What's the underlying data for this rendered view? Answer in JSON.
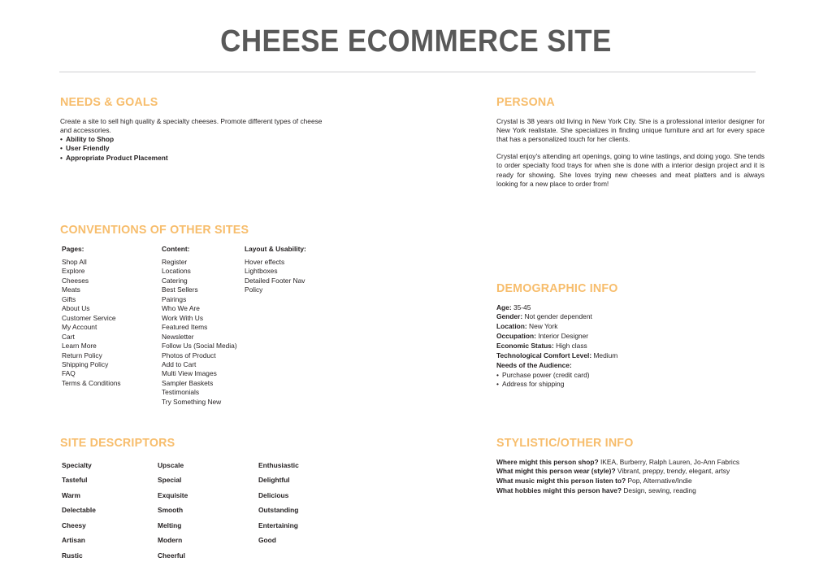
{
  "document": {
    "title": "CHEESE ECOMMERCE SITE",
    "title_color": "#595959",
    "accent_color": "#f7bd6c",
    "rule_color": "#cfd0d2"
  },
  "needs_goals": {
    "heading": "NEEDS & GOALS",
    "paragraph": "Create a site to sell high quality & specialty cheeses. Promote different types of cheese and accessories.",
    "bullets": [
      "Ability to Shop",
      "User Friendly",
      "Appropriate Product Placement"
    ]
  },
  "persona": {
    "heading": "PERSONA",
    "paragraph1": "Crystal is 38 years old living in New York City. She is a professional interior designer for New York realistate. She specializes in finding unique furniture and art for every space that has a personalized touch for her clients.",
    "paragraph2": "Crystal enjoy's attending art openings, going to wine tastings, and doing yogo. She tends to order specialty food trays for when she is done with a interior design project and it is ready for showing. She loves trying new cheeses and meat platters and is always looking for a new place to order from!"
  },
  "conventions": {
    "heading": "CONVENTIONS OF OTHER SITES",
    "columns": [
      {
        "header": "Pages:",
        "items": [
          "Shop All",
          "Explore",
          "Cheeses",
          "Meats",
          "Gifts",
          "About Us",
          "Customer Service",
          "My Account",
          "Cart",
          "Learn More",
          "Return Policy",
          "Shipping Policy",
          "FAQ",
          "Terms & Conditions"
        ]
      },
      {
        "header": "Content:",
        "items": [
          "Register",
          "Locations",
          "Catering",
          "Best Sellers",
          "Pairings",
          "Who We Are",
          "Work With Us",
          "Featured Items",
          "Newsletter",
          "Follow Us (Social Media)",
          "Photos of Product",
          "Add to Cart",
          "Multi View Images",
          "Sampler Baskets",
          "Testimonials",
          "Try Something New"
        ]
      },
      {
        "header": "Layout & Usability:",
        "items": [
          "Hover effects",
          "Lightboxes",
          "Detailed Footer Nav",
          "Policy"
        ]
      }
    ]
  },
  "demographic": {
    "heading": "DEMOGRAPHIC INFO",
    "fields": [
      {
        "label": "Age:",
        "value": "35-45"
      },
      {
        "label": "Gender:",
        "value": "Not gender dependent"
      },
      {
        "label": "Location:",
        "value": "New York"
      },
      {
        "label": "Occupation:",
        "value": "Interior Designer"
      },
      {
        "label": "Economic Status:",
        "value": "High class"
      },
      {
        "label": "Technological Comfort Level:",
        "value": "Medium"
      }
    ],
    "audience_label": "Needs of the Audience:",
    "audience_bullets": [
      "Purchase power (credit card)",
      "Address for shipping"
    ]
  },
  "site_descriptors": {
    "heading": "SITE DESCRIPTORS",
    "columns": [
      [
        "Specialty",
        "Tasteful",
        "Warm",
        "Delectable",
        "Cheesy",
        "Artisan",
        "Rustic"
      ],
      [
        "Upscale",
        "Special",
        "Exquisite",
        "Smooth",
        "Melting",
        "Modern",
        "Cheerful"
      ],
      [
        "Enthusiastic",
        "Delightful",
        "Delicious",
        "Outstanding",
        "Entertaining",
        "Good"
      ]
    ]
  },
  "stylistic": {
    "heading": "STYLISTIC/OTHER INFO",
    "qa": [
      {
        "question": "Where might this person shop?",
        "answer": "IKEA, Burberry, Ralph Lauren, Jo-Ann Fabrics"
      },
      {
        "question": "What might this person wear (style)?",
        "answer": "Vibrant, preppy, trendy, elegant, artsy"
      },
      {
        "question": "What music might this person listen to?",
        "answer": "Pop, Alternative/Indie"
      },
      {
        "question": "What hobbies might this person have?",
        "answer": "Design, sewing, reading"
      }
    ]
  }
}
